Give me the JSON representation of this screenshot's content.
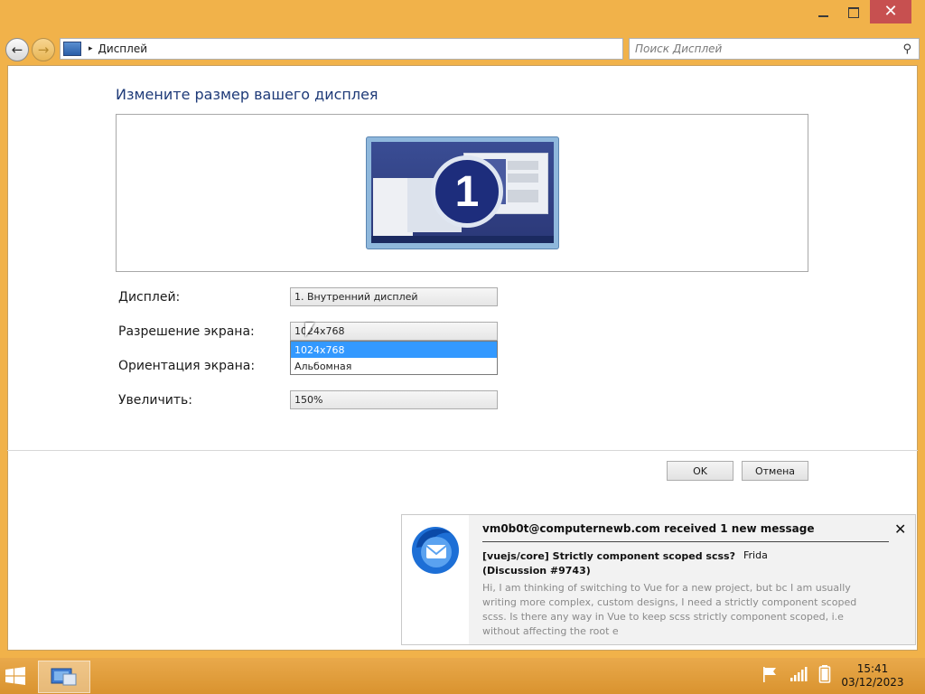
{
  "window": {
    "minimize_label": "",
    "maximize_label": "",
    "close_glyph": "✕"
  },
  "nav": {
    "back_glyph": "←",
    "forward_glyph": "→",
    "address_separator": "▸",
    "address_text": "Дисплей",
    "search_placeholder": "Поиск Дисплей",
    "search_icon": "⚲"
  },
  "main": {
    "heading": "Измените размер вашего дисплея",
    "monitor_number": "1",
    "rows": [
      {
        "label": "Дисплей:",
        "value": "1. Внутренний дисплей"
      },
      {
        "label": "Разрешение экрана:",
        "value": "1024x768"
      },
      {
        "label": "Ориентация экрана:",
        "value": "Альбомная"
      },
      {
        "label": "Увеличить:",
        "value": "150%"
      }
    ],
    "dropdown_options": [
      "1024x768",
      "Альбомная"
    ],
    "ok_label": "OK",
    "cancel_label": "Отмена"
  },
  "notification": {
    "title": "vm0b0t@computernewb.com received 1 new message",
    "close_glyph": "✕",
    "subject": "[vuejs/core] Strictly component scoped scss? (Discussion #9743)",
    "from": "Frida",
    "body": "Hi, I am thinking of switching to Vue for a new project, but bc I am usually writing more complex, custom designs, I need a strictly component scoped scss. Is there any way in Vue to keep scss strictly component scoped, i.e without affecting the root e"
  },
  "taskbar": {
    "time": "15:41",
    "date": "03/12/2023"
  },
  "colors": {
    "accent_frame": "#f1b24a",
    "selection": "#3399ff",
    "heading": "#1e3a78",
    "close_button": "#c75050"
  }
}
